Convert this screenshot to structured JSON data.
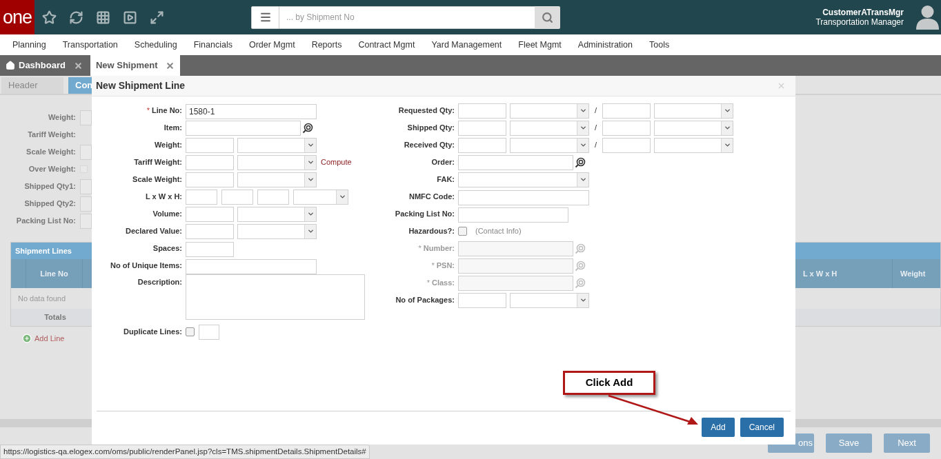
{
  "header": {
    "logo": "one",
    "search_placeholder": "... by Shipment No",
    "user_name": "CustomerATransMgr",
    "user_role": "Transportation Manager"
  },
  "menu": [
    "Planning",
    "Transportation",
    "Scheduling",
    "Financials",
    "Order Mgmt",
    "Reports",
    "Contract Mgmt",
    "Yard Management",
    "Fleet Mgmt",
    "Administration",
    "Tools"
  ],
  "tabs": [
    {
      "label": "Dashboard",
      "selected": false
    },
    {
      "label": "New Shipment",
      "selected": true
    }
  ],
  "page": {
    "subtabs": [
      {
        "label": "Header",
        "selected": false
      },
      {
        "label": "Con",
        "selected": true
      }
    ],
    "fields": [
      {
        "label": "Weight:",
        "kind": "input"
      },
      {
        "label": "Tariff Weight:",
        "kind": "none"
      },
      {
        "label": "Scale Weight:",
        "kind": "input"
      },
      {
        "label": "Over Weight:",
        "kind": "checkbox",
        "checked": false
      },
      {
        "label": "Shipped Qty1:",
        "kind": "input"
      },
      {
        "label": "Shipped Qty2:",
        "kind": "input"
      },
      {
        "label": "Packing List No:",
        "kind": "input"
      }
    ],
    "shipment_lines": {
      "title": "Shipment Lines",
      "left_columns": [
        "Line No"
      ],
      "right_columns": [
        "L x W x H",
        "Weight"
      ],
      "empty": "No data found",
      "totals": "Totals"
    },
    "add_line": "Add Line",
    "buttons": [
      "ons",
      "Save",
      "Next"
    ]
  },
  "modal": {
    "title": "New Shipment Line",
    "required_mark": "*",
    "left_fields": [
      {
        "label": "Line No:",
        "kind": "text",
        "required": true,
        "value": "1580-1"
      },
      {
        "label": "Item:",
        "kind": "lookup",
        "required": false
      },
      {
        "label": "Weight:",
        "kind": "measure",
        "required": false
      },
      {
        "label": "Tariff Weight:",
        "kind": "measure",
        "required": false,
        "link": "Compute"
      },
      {
        "label": "Scale Weight:",
        "kind": "measure",
        "required": false
      },
      {
        "label": "L x W x H:",
        "kind": "dimensions",
        "required": false
      },
      {
        "label": "Volume:",
        "kind": "measure",
        "required": false
      },
      {
        "label": "Declared Value:",
        "kind": "measure",
        "required": false
      },
      {
        "label": "Spaces:",
        "kind": "short",
        "required": false
      },
      {
        "label": "No of Unique Items:",
        "kind": "text",
        "required": false
      },
      {
        "label": "Description:",
        "kind": "textarea",
        "required": false
      },
      {
        "label": "Duplicate Lines:",
        "kind": "duplicate",
        "required": false,
        "checked": false
      }
    ],
    "right_fields": [
      {
        "label": "Requested Qty:",
        "kind": "qty_pair",
        "required": false,
        "disabled": false,
        "separator": "/"
      },
      {
        "label": "Shipped Qty:",
        "kind": "qty_pair",
        "required": false,
        "disabled": false,
        "separator": "/"
      },
      {
        "label": "Received Qty:",
        "kind": "qty_pair",
        "required": false,
        "disabled": false,
        "separator": "/"
      },
      {
        "label": "Order:",
        "kind": "lookup",
        "required": false,
        "disabled": false
      },
      {
        "label": "FAK:",
        "kind": "select",
        "required": false,
        "disabled": false
      },
      {
        "label": "NMFC Code:",
        "kind": "text",
        "required": false,
        "disabled": false
      },
      {
        "label": "Packing List No:",
        "kind": "medium",
        "required": false,
        "disabled": false
      },
      {
        "label": "Hazardous?:",
        "kind": "checkbox",
        "required": false,
        "disabled": false,
        "checked": false,
        "note": "(Contact Info)"
      },
      {
        "label": "Number:",
        "kind": "lookup",
        "required": true,
        "disabled": true
      },
      {
        "label": "PSN:",
        "kind": "lookup",
        "required": true,
        "disabled": true
      },
      {
        "label": "Class:",
        "kind": "lookup",
        "required": true,
        "disabled": true
      },
      {
        "label": "No of Packages:",
        "kind": "measure",
        "required": false,
        "disabled": false
      }
    ],
    "buttons": [
      {
        "label": "Add"
      },
      {
        "label": "Cancel"
      }
    ]
  },
  "callout": "Click Add",
  "status_url": "https://logistics-qa.elogex.com/oms/public/renderPanel.jsp?cls=TMS.shipmentDetails.ShipmentDetails#"
}
